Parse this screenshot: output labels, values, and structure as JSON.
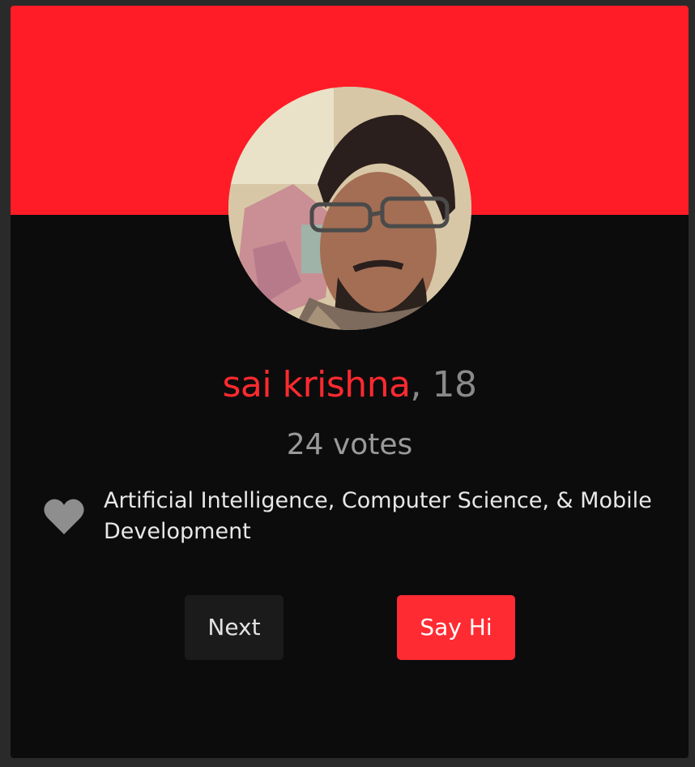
{
  "profile": {
    "name": "sai krishna",
    "age_text": ", 18",
    "votes_text": "24 votes",
    "interests": "Artificial Intelligence, Computer Science, & Mobile Development"
  },
  "actions": {
    "next_label": "Next",
    "say_hi_label": "Say Hi"
  },
  "icons": {
    "interests_icon": "heart-icon"
  },
  "colors": {
    "accent": "#ff1c27",
    "card_background": "#0c0c0d",
    "muted_text": "#8a8a8a",
    "next_button": "#1b1b1c",
    "say_hi_button": "#ff2b33"
  }
}
